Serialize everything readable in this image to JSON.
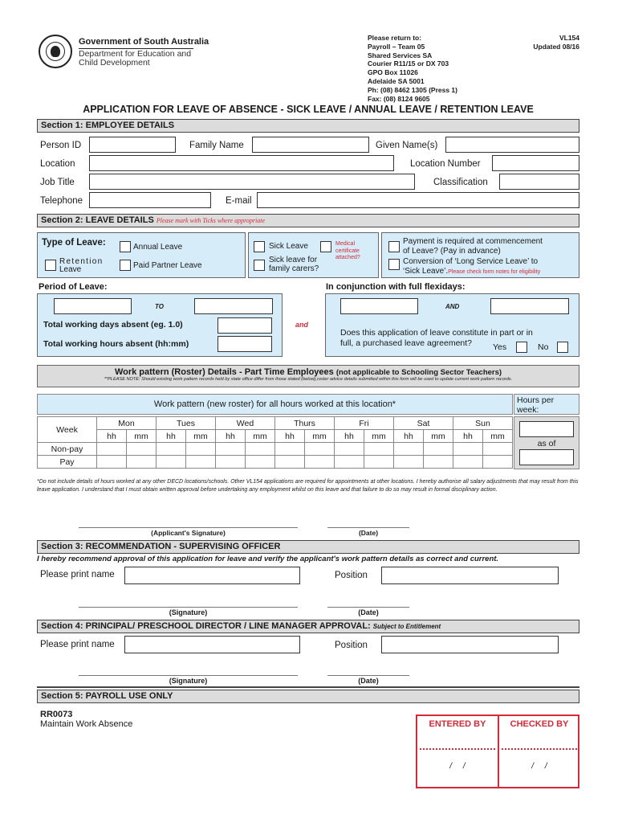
{
  "header": {
    "logo_text": "South Australia",
    "government": "Government of South Australia",
    "department_lines": [
      "Department for Education and",
      "Child Development"
    ],
    "return_to": [
      "Please return to:",
      "Payroll – Team 05",
      "Shared Services SA",
      "Courier R11/15 or DX 703",
      "GPO Box 11026",
      "Adelaide SA 5001",
      "Ph: (08) 8462 1305 (Press 1)",
      "Fax: (08) 8124 9605"
    ],
    "form_code": "VL154",
    "updated": "Updated 08/16"
  },
  "title": "APPLICATION FOR LEAVE OF ABSENCE - SICK LEAVE / ANNUAL LEAVE / RETENTION LEAVE",
  "section1": {
    "heading": "Section 1: EMPLOYEE DETAILS",
    "person_id": {
      "label": "Person ID",
      "value": ""
    },
    "family_name": {
      "label": "Family Name",
      "value": ""
    },
    "given_names": {
      "label": "Given Name(s)",
      "value": ""
    },
    "location": {
      "label": "Location",
      "value": ""
    },
    "location_number": {
      "label": "Location Number",
      "value": ""
    },
    "job_title": {
      "label": "Job Title",
      "value": ""
    },
    "classification": {
      "label": "Classification",
      "value": ""
    },
    "telephone": {
      "label": "Telephone",
      "value": ""
    },
    "email": {
      "label": "E-mail",
      "value": ""
    }
  },
  "section2": {
    "heading": "Section 2: LEAVE DETAILS",
    "heading_note": "Please mark with Ticks where appropriate",
    "type_of_leave_label": "Type of Leave:",
    "annual_leave": "Annual Leave",
    "retention_leave_lines": [
      "Retention",
      "Leave"
    ],
    "paid_partner_leave": "Paid Partner Leave",
    "sick_leave": "Sick Leave",
    "medical_certificate_lines": [
      "Medical",
      "certificate",
      "attached?"
    ],
    "sick_leave_carers_lines": [
      "Sick leave for",
      "family carers?"
    ],
    "payment_advance_lines": [
      "Payment is required at commencement",
      "of Leave? (Pay in advance)"
    ],
    "conversion_lines": [
      "Conversion of ‘Long Service Leave’ to",
      "‘Sick Leave’."
    ],
    "conversion_note": "Please check form notes for eligibility",
    "period_label": "Period of Leave:",
    "to_label": "TO",
    "days_absent_label": "Total working days absent (eg. 1.0)",
    "hours_absent_label": "Total working hours absent (hh:mm)",
    "and_label": "and",
    "flexi_label": "In conjunction with full flexidays:",
    "flexi_and_label": "AND",
    "purchased_question_lines": [
      "Does this application of leave constitute in part or in",
      "full, a purchased leave agreement?"
    ],
    "yes_label": "Yes",
    "no_label": "No"
  },
  "work_pattern": {
    "heading": "Work pattern (Roster) Details - Part Time Employees",
    "heading_note": "(not applicable to Schooling Sector Teachers)",
    "notice": "**PLEASE NOTE: Should existing work pattern records held by state office differ from those stated (below),roster advice details submitted within this form will be used to update current work pattern records.",
    "table_caption": "Work pattern (new roster) for all hours worked at this location*",
    "hours_per_week_label": "Hours per week:",
    "as_of_label": "as of",
    "week_label": "Week",
    "days": [
      "Mon",
      "Tues",
      "Wed",
      "Thurs",
      "Fri",
      "Sat",
      "Sun"
    ],
    "hh": "hh",
    "mm": "mm",
    "rows": [
      "Non-pay",
      "Pay"
    ],
    "disclaimer": "*Do not include details of hours worked at any other DECD locations/schools. Other VL154 applications are required for appointments at other locations. I hereby authorise all salary adjustments that may result from this leave application. I understand that I must obtain written approval before undertaking any employment whilst on this leave and that failure to do so may result in formal disciplinary action.",
    "applicant_signature": "(Applicant's Signature)",
    "date": "(Date)"
  },
  "section3": {
    "heading": "Section 3: RECOMMENDATION - SUPERVISING OFFICER",
    "statement": "I hereby recommend approval of this application for leave and verify the applicant's work pattern details as correct and current.",
    "print_name_label": "Please print name",
    "position_label": "Position",
    "signature": "(Signature)",
    "date": "(Date)"
  },
  "section4": {
    "heading": "Section 4: PRINCIPAL/ PRESCHOOL DIRECTOR / LINE MANAGER APPROVAL:",
    "heading_note": "Subject to Entitlement",
    "print_name_label": "Please print name",
    "position_label": "Position",
    "signature": "(Signature)",
    "date": "(Date)"
  },
  "section5": {
    "heading": "Section 5: PAYROLL USE ONLY",
    "code": "RR0073",
    "description": "Maintain Work Absence",
    "entered_by": "ENTERED BY",
    "checked_by": "CHECKED BY",
    "date_placeholder": "/     /"
  },
  "colors": {
    "section_bg": "#dcdcdc",
    "panel_bg": "#d6ecf8",
    "accent_red": "#d42a3a"
  }
}
